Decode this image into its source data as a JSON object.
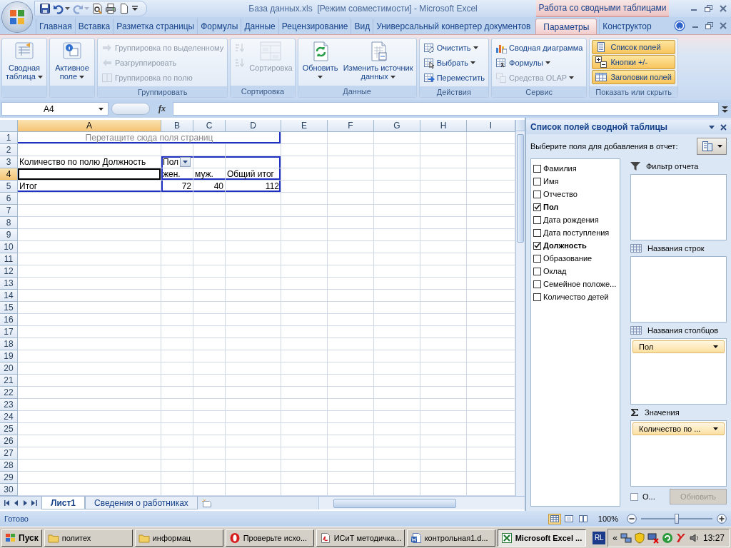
{
  "title_bar": {
    "quick_access": [
      {
        "kind": "save",
        "disabled": false
      },
      {
        "kind": "undo",
        "disabled": false
      },
      {
        "kind": "redo",
        "disabled": true
      },
      {
        "kind": "print_preview",
        "disabled": false
      },
      {
        "kind": "print",
        "disabled": false
      },
      {
        "kind": "new",
        "disabled": false
      }
    ],
    "title": "База данных.xls  [Режим совместимости] - Microsoft Excel",
    "context_group": "Работа со сводными таблицами"
  },
  "ribbon_tabs": [
    {
      "label": "Главная",
      "selected": false
    },
    {
      "label": "Вставка",
      "selected": false
    },
    {
      "label": "Разметка страницы",
      "selected": false
    },
    {
      "label": "Формулы",
      "selected": false
    },
    {
      "label": "Данные",
      "selected": false
    },
    {
      "label": "Рецензирование",
      "selected": false
    },
    {
      "label": "Вид",
      "selected": false
    },
    {
      "label": "Универсальный конвертер документов",
      "selected": false
    },
    {
      "label": "Параметры",
      "selected": true
    },
    {
      "label": "Конструктор",
      "selected": false
    }
  ],
  "ribbon_groups": [
    {
      "commands": [
        {
          "kind": "large",
          "label": "Сводная таблица",
          "dropdown": true,
          "disabled": false
        }
      ]
    },
    {
      "commands": [
        {
          "kind": "large",
          "label": "Активное поле",
          "dropdown": true,
          "disabled": false
        }
      ]
    },
    {
      "label": "Группировать",
      "commands": [
        {
          "kind": "small",
          "label": "Группировка по выделенному",
          "disabled": true
        },
        {
          "kind": "small",
          "label": "Разгруппировать",
          "disabled": true
        },
        {
          "kind": "small",
          "label": "Группировка по полю",
          "disabled": true
        }
      ]
    },
    {
      "label": "Сортировка",
      "commands": [
        {
          "kind": "icon",
          "disabled": true
        },
        {
          "kind": "icon",
          "disabled": true
        },
        {
          "kind": "large",
          "label": "Сортировка",
          "disabled": true
        }
      ]
    },
    {
      "label": "Данные",
      "commands": [
        {
          "kind": "large",
          "label": "Обновить",
          "dropdown": true,
          "disabled": false
        },
        {
          "kind": "large",
          "label": "Изменить источник данных",
          "dropdown": true,
          "disabled": false
        }
      ]
    },
    {
      "label": "Действия",
      "commands": [
        {
          "kind": "small",
          "label": "Очистить",
          "dropdown": true,
          "disabled": false
        },
        {
          "kind": "small",
          "label": "Выбрать",
          "dropdown": true,
          "disabled": false
        },
        {
          "kind": "small",
          "label": "Переместить",
          "disabled": false
        }
      ]
    },
    {
      "label": "Сервис",
      "commands": [
        {
          "kind": "small",
          "label": "Сводная диаграмма",
          "disabled": false
        },
        {
          "kind": "small",
          "label": "Формулы",
          "dropdown": true,
          "disabled": false
        },
        {
          "kind": "small",
          "label": "Средства OLAP",
          "dropdown": true,
          "disabled": true
        }
      ]
    },
    {
      "label": "Показать или скрыть",
      "commands": [
        {
          "kind": "toggle",
          "label": "Список полей",
          "on": true
        },
        {
          "kind": "toggle",
          "label": "Кнопки +/-",
          "on": true
        },
        {
          "kind": "toggle",
          "label": "Заголовки полей",
          "on": true
        }
      ]
    }
  ],
  "formula_bar": {
    "name_box": "A4",
    "function_label": "fx"
  },
  "sheet": {
    "columns": [
      {
        "label": "A",
        "selected": true
      },
      {
        "label": "B",
        "selected": false
      },
      {
        "label": "C",
        "selected": false
      },
      {
        "label": "D",
        "selected": false
      },
      {
        "label": "E",
        "selected": false
      },
      {
        "label": "F",
        "selected": false
      },
      {
        "label": "G",
        "selected": false
      },
      {
        "label": "H",
        "selected": false
      },
      {
        "label": "I",
        "selected": false
      }
    ],
    "rows": [
      {
        "label": "1",
        "selected": false
      },
      {
        "label": "2",
        "selected": false
      },
      {
        "label": "3",
        "selected": false
      },
      {
        "label": "4",
        "selected": true
      },
      {
        "label": "5",
        "selected": false
      },
      {
        "label": "6",
        "selected": false
      },
      {
        "label": "7",
        "selected": false
      },
      {
        "label": "8",
        "selected": false
      },
      {
        "label": "9",
        "selected": false
      },
      {
        "label": "10",
        "selected": false
      },
      {
        "label": "11",
        "selected": false
      },
      {
        "label": "12",
        "selected": false
      },
      {
        "label": "13",
        "selected": false
      },
      {
        "label": "14",
        "selected": false
      },
      {
        "label": "15",
        "selected": false
      },
      {
        "label": "16",
        "selected": false
      },
      {
        "label": "17",
        "selected": false
      },
      {
        "label": "18",
        "selected": false
      },
      {
        "label": "19",
        "selected": false
      },
      {
        "label": "20",
        "selected": false
      },
      {
        "label": "21",
        "selected": false
      },
      {
        "label": "22",
        "selected": false
      },
      {
        "label": "23",
        "selected": false
      },
      {
        "label": "24",
        "selected": false
      },
      {
        "label": "25",
        "selected": false
      },
      {
        "label": "26",
        "selected": false
      },
      {
        "label": "27",
        "selected": false
      },
      {
        "label": "28",
        "selected": false
      },
      {
        "label": "29",
        "selected": false
      },
      {
        "label": "30",
        "selected": false
      }
    ],
    "pivot": {
      "page_area_hint": "Перетащите сюда поля страниц",
      "values_caption": "Количество по полю Должность",
      "column_field": "Пол",
      "column_items": [
        "жен.",
        "муж.",
        "Общий итог"
      ],
      "grand_total_label": "Итог",
      "totals": [
        "72",
        "40",
        "112"
      ]
    },
    "tabs": [
      {
        "label": "Лист1",
        "selected": true
      },
      {
        "label": "Сведения о работниках",
        "selected": false
      }
    ]
  },
  "field_list": {
    "title": "Список полей сводной таблицы",
    "prompt": "Выберите поля для добавления в отчет:",
    "fields": [
      {
        "label": "Фамилия",
        "checked": false
      },
      {
        "label": "Имя",
        "checked": false
      },
      {
        "label": "Отчество",
        "checked": false
      },
      {
        "label": "Пол",
        "checked": true
      },
      {
        "label": "Дата рождения",
        "checked": false
      },
      {
        "label": "Дата поступления",
        "checked": false
      },
      {
        "label": "Должность",
        "checked": true
      },
      {
        "label": "Образование",
        "checked": false
      },
      {
        "label": "Оклад",
        "checked": false
      },
      {
        "label": "Семейное положе...",
        "checked": false
      },
      {
        "label": "Количество детей",
        "checked": false
      }
    ],
    "areas": [
      {
        "kind": "filter",
        "label": "Фильтр отчета"
      },
      {
        "kind": "rows",
        "label": "Названия строк"
      },
      {
        "kind": "columns",
        "label": "Названия столбцов",
        "items": [
          "Пол"
        ]
      },
      {
        "kind": "values",
        "label": "Значения",
        "items": [
          "Количество по ..."
        ]
      }
    ],
    "defer_update": {
      "label": "О...",
      "checked": false
    },
    "update_button": {
      "label": "Обновить",
      "disabled": true
    }
  },
  "status_bar": {
    "status": "Готово",
    "views": [
      {
        "kind": "normal",
        "selected": true
      },
      {
        "kind": "page_layout",
        "selected": false
      },
      {
        "kind": "page_break",
        "selected": false
      }
    ],
    "zoom": "100%",
    "zoom_slider": {
      "level": 0.5
    }
  },
  "taskbar": {
    "start": "Пуск",
    "items": [
      {
        "kind": "folder",
        "label": "политех",
        "selected": false
      },
      {
        "kind": "folder",
        "label": "информац",
        "selected": false
      },
      {
        "kind": "opera",
        "label": "Проверьте исхо...",
        "selected": false
      },
      {
        "kind": "pdf",
        "label": "ИСиТ методичка...",
        "selected": false
      },
      {
        "kind": "word",
        "label": "контрольная1.d...",
        "selected": false
      },
      {
        "kind": "excel",
        "label": "Microsoft Excel ...",
        "selected": true
      }
    ],
    "language": "RL",
    "chevron": "«",
    "clock": "13:27"
  }
}
